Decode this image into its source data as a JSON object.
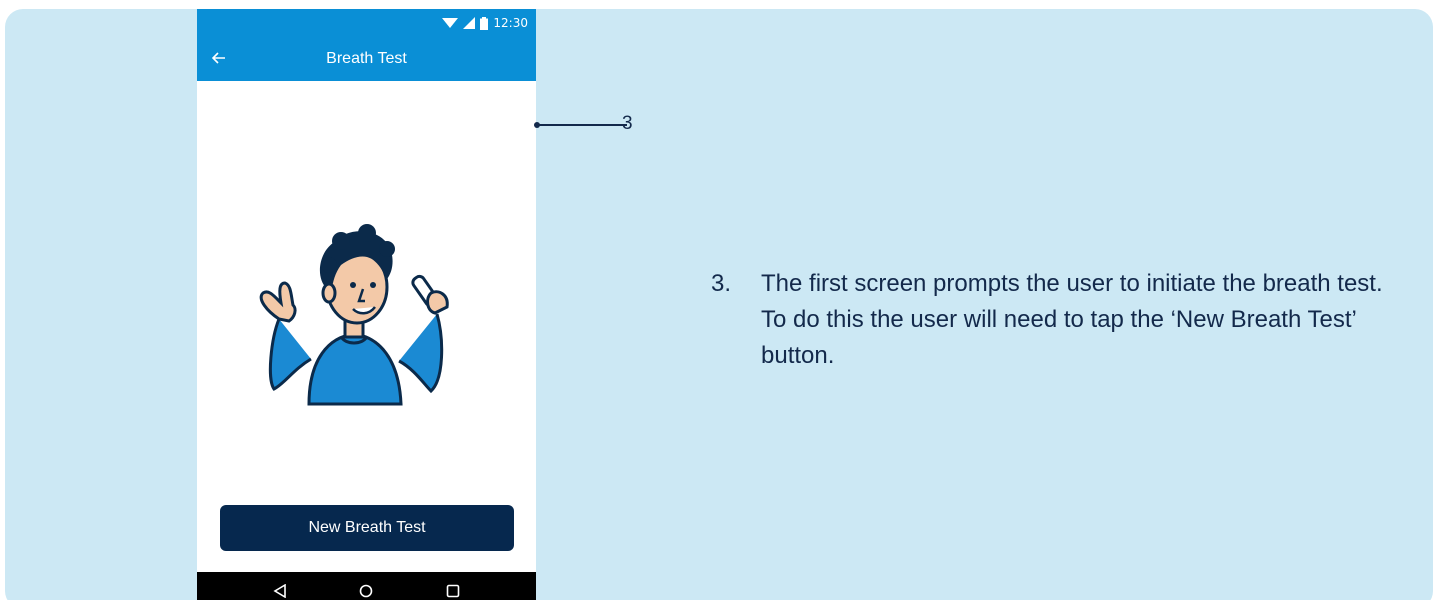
{
  "colors": {
    "panel_bg": "#cce8f4",
    "app_bar": "#0a8fd6",
    "primary_button": "#06284e",
    "text_dark": "#13294b"
  },
  "status_bar": {
    "time": "12:30",
    "icons": [
      "wifi-icon",
      "signal-icon",
      "battery-icon"
    ]
  },
  "app_bar": {
    "back_icon": "arrow-left-icon",
    "title": "Breath Test"
  },
  "main": {
    "illustration": "person-holding-breath-test-device",
    "button_label": "New Breath Test"
  },
  "nav_bar": {
    "icons": [
      "back-triangle-icon",
      "home-circle-icon",
      "recents-square-icon"
    ]
  },
  "callout": {
    "number": "3"
  },
  "instruction": {
    "number": "3.",
    "text": "The first screen prompts the user to initiate the breath test. To do this the user will need to tap the ‘New Breath Test’ button."
  }
}
